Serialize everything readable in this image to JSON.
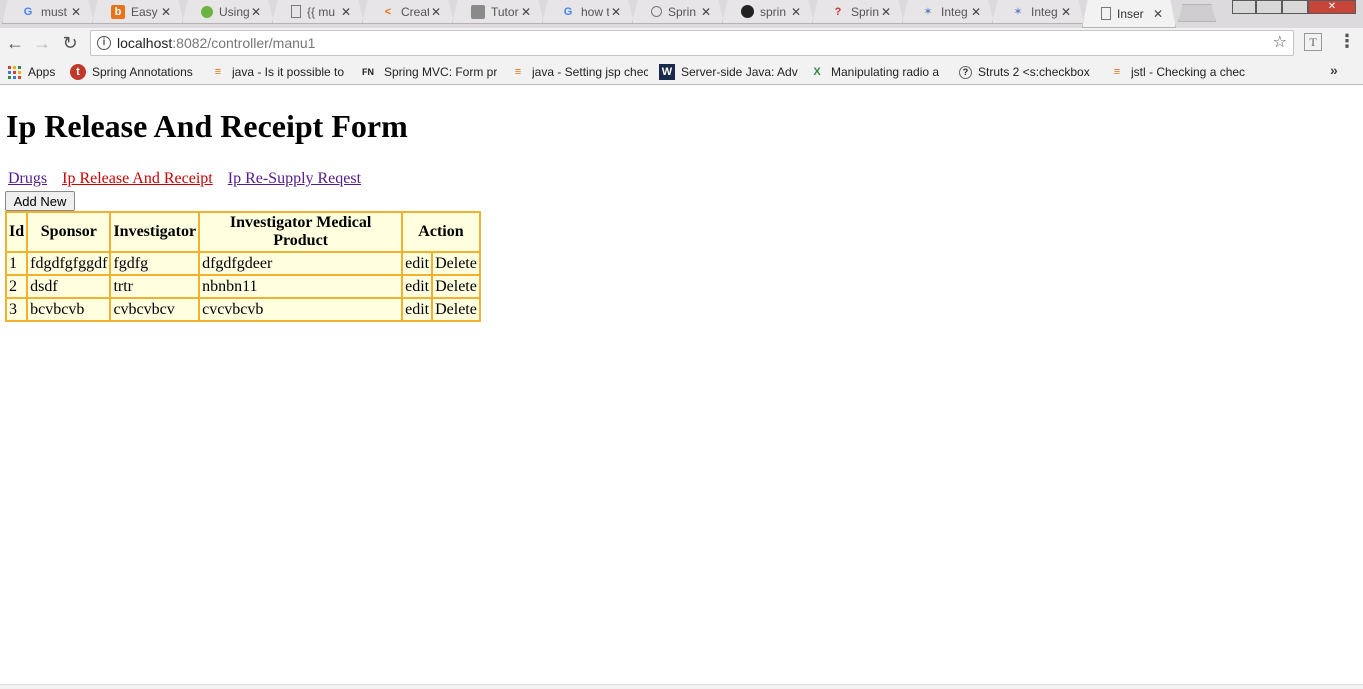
{
  "browser": {
    "tabs": [
      {
        "icon": "google-icon",
        "title": "must",
        "active": false
      },
      {
        "icon": "easy-icon",
        "title": "Easy",
        "active": false
      },
      {
        "icon": "spring-leaf-icon",
        "title": "Using",
        "active": false
      },
      {
        "icon": "page-icon",
        "title": "{{ mu",
        "active": false
      },
      {
        "icon": "code-icon",
        "title": "Creat",
        "active": false
      },
      {
        "icon": "person-icon",
        "title": "Tutor",
        "active": false
      },
      {
        "icon": "google-icon",
        "title": "how t",
        "active": false
      },
      {
        "icon": "spring-icon",
        "title": "Sprin",
        "active": false
      },
      {
        "icon": "github-icon",
        "title": "sprin",
        "active": false
      },
      {
        "icon": "question-icon",
        "title": "Sprin",
        "active": false
      },
      {
        "icon": "integ-icon",
        "title": "Integ",
        "active": false
      },
      {
        "icon": "integ-icon",
        "title": "Integ",
        "active": false
      },
      {
        "icon": "page-icon",
        "title": "Inser",
        "active": true
      }
    ],
    "close_glyph": "✕",
    "url_host": "localhost",
    "url_path": ":8082/controller/manu1",
    "bookmarks": [
      {
        "icon": "apps-icon",
        "label": "Apps"
      },
      {
        "icon": "spring-annotations-icon",
        "label": "Spring Annotations"
      },
      {
        "icon": "stackoverflow-icon",
        "label": "java - Is it possible to"
      },
      {
        "icon": "fn-icon",
        "label": "Spring MVC: Form pr"
      },
      {
        "icon": "stackoverflow-icon",
        "label": "java - Setting jsp chec"
      },
      {
        "icon": "w-icon",
        "label": "Server-side Java: Adv"
      },
      {
        "icon": "x-icon",
        "label": "Manipulating radio a"
      },
      {
        "icon": "struts-icon",
        "label": "Struts 2 <s:checkbox"
      },
      {
        "icon": "stackoverflow-icon",
        "label": "jstl - Checking a chec"
      }
    ],
    "more_glyph": "»"
  },
  "page": {
    "title": "Ip Release And Receipt Form",
    "nav": {
      "drugs": "Drugs",
      "ip_release": "Ip Release And Receipt",
      "ip_resupply": "Ip Re-Supply Reqest"
    },
    "add_new_label": "Add New",
    "table": {
      "headers": [
        "Id",
        "Sponsor",
        "Investigator",
        "Investigator Medical Product",
        "Action"
      ],
      "rows": [
        {
          "id": "1",
          "sponsor": "fdgdfgfggdf",
          "investigator": "fgdfg",
          "product": "dfgdfgdeer",
          "edit": "edit",
          "delete": "Delete"
        },
        {
          "id": "2",
          "sponsor": "dsdf",
          "investigator": "trtr",
          "product": "nbnbn11",
          "edit": "edit",
          "delete": "Delete"
        },
        {
          "id": "3",
          "sponsor": "bcvbcvb",
          "investigator": "cvbcvbcv",
          "product": "cvcvbcvb",
          "edit": "edit",
          "delete": "Delete"
        }
      ]
    }
  },
  "colors": {
    "table_border": "#f0b030",
    "table_bg": "#ffffe0",
    "link_visited": "#551a8b",
    "link_active": "#cc0000"
  }
}
